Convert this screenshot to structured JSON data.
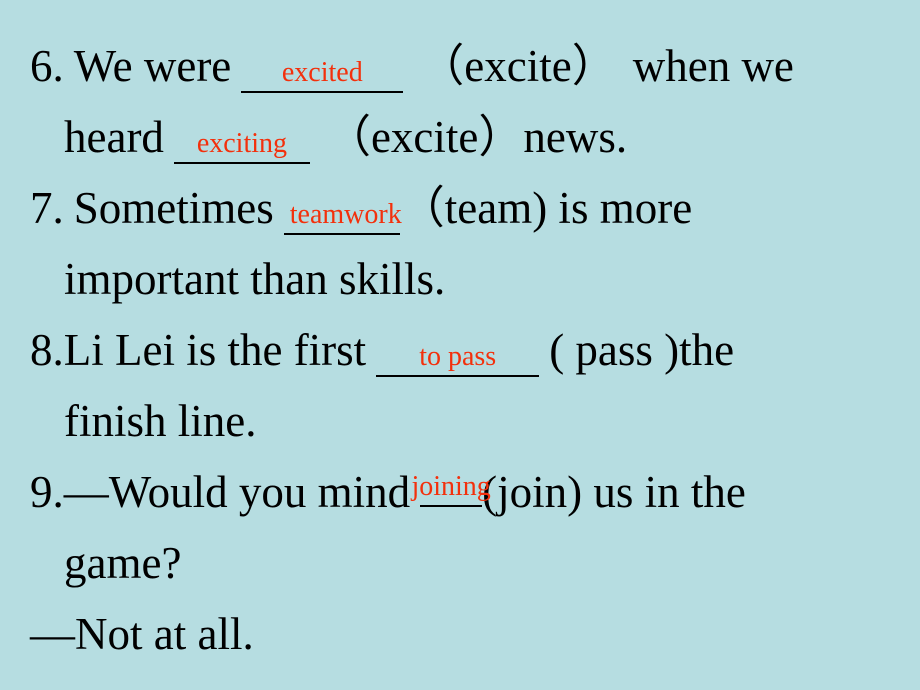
{
  "slide": {
    "background_color": "#b6dde1",
    "text_color": "#000000",
    "answer_color": "#f3300c",
    "items": [
      {
        "number": "6.",
        "lines": [
          {
            "before": "We were",
            "answer": "excited",
            "after": "（excite）  when we"
          },
          {
            "before": "heard",
            "answer": "exciting",
            "after": "（excite）news."
          }
        ]
      },
      {
        "number": "7.",
        "lines": [
          {
            "before": "Sometimes",
            "answer": "teamwork",
            "after": "（team) is more"
          },
          {
            "before": "important than skills.",
            "answer": "",
            "after": ""
          }
        ]
      },
      {
        "number": "8.",
        "lines": [
          {
            "before": "Li Lei is the first",
            "answer": "to pass",
            "after": "( pass )the"
          },
          {
            "before": "finish line.",
            "answer": "",
            "after": ""
          }
        ]
      },
      {
        "number": "9.",
        "lines": [
          {
            "before": "—Would you mind",
            "answer": "joining",
            "after": "(join) us in the"
          },
          {
            "before": "game?",
            "answer": "",
            "after": ""
          },
          {
            "before": "—Not at all.",
            "answer": "",
            "after": ""
          }
        ]
      }
    ]
  },
  "text": {
    "l1_num": "6.",
    "l1_a": "We were",
    "l1_blank": "excited",
    "l1_b": "（excite）",
    "l1_c": "when we",
    "l2_a": "heard",
    "l2_blank": "exciting",
    "l2_b": "（excite）news.",
    "l3_num": "7.",
    "l3_a": "Sometimes",
    "l3_blank": "teamwork",
    "l3_b": "（team) is more",
    "l4_a": "important than skills.",
    "l5_num": "8.",
    "l5_a": "Li Lei is the first",
    "l5_blank": "to pass",
    "l5_b": "( pass )the",
    "l6_a": "finish line.",
    "l7_num": "9.",
    "l7_a": "—Would you mind",
    "l7_blank": "joining",
    "l7_b": "(join) us in the",
    "l8_a": "game?",
    "l9_a": "—Not at all."
  }
}
